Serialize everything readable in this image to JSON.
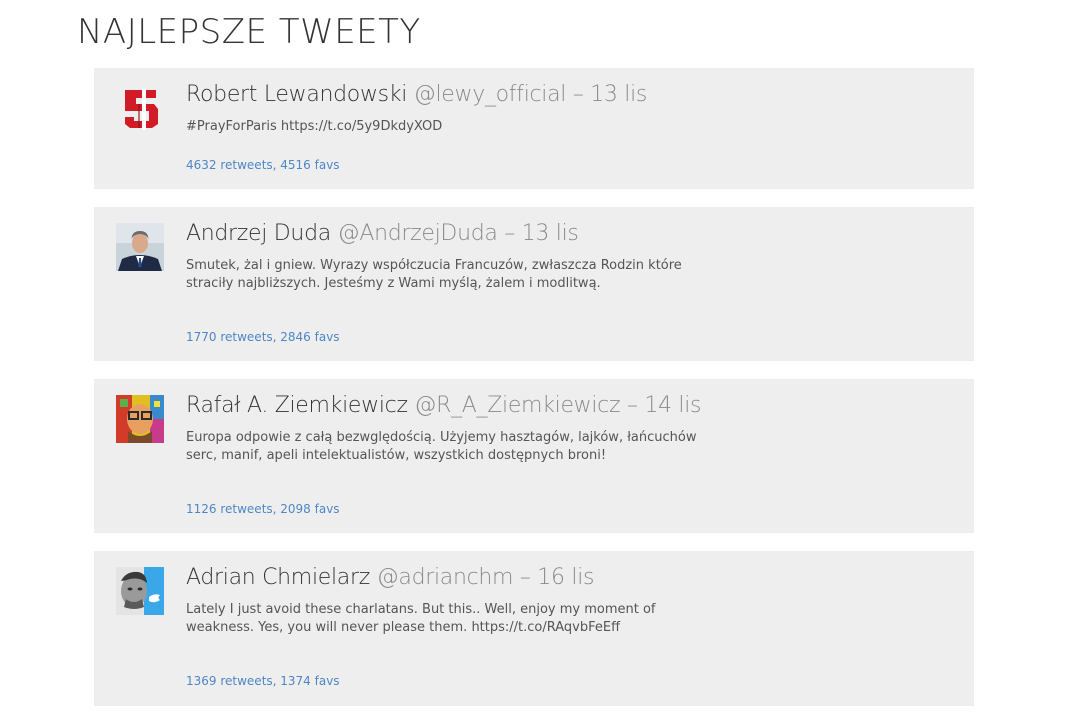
{
  "page": {
    "title": "NAJLEPSZE TWEETY"
  },
  "colors": {
    "card_bg": "#eeeeee",
    "link": "#4f86c6",
    "muted": "#8a8a8a"
  },
  "tweets": [
    {
      "name": "Robert Lewandowski",
      "handle": "@lewy_official",
      "separator": "–",
      "date": "13 lis",
      "text": "#PrayForParis https://t.co/5y9DkdyXOD",
      "stats": "4632 retweets, 4516 favs",
      "avatar_icon": "number-9-logo-avatar"
    },
    {
      "name": "Andrzej Duda",
      "handle": "@AndrzejDuda",
      "separator": "–",
      "date": "13 lis",
      "text": "Smutek, żal i gniew. Wyrazy współczucia Francuzów, zwłaszcza Rodzin które straciły najbliższych. Jesteśmy z Wami myślą, żalem i modlitwą.",
      "stats": "1770 retweets, 2846 favs",
      "avatar_icon": "portrait-avatar"
    },
    {
      "name": "Rafał A. Ziemkiewicz",
      "handle": "@R_A_Ziemkiewicz",
      "separator": "–",
      "date": "14 lis",
      "text": "Europa odpowie z całą bezwględością. Użyjemy hasztagów, lajków, łańcuchów serc, manif, apeli intelektualistów, wszystkich dostępnych broni!",
      "stats": "1126 retweets, 2098 favs",
      "avatar_icon": "colorful-portrait-avatar"
    },
    {
      "name": "Adrian Chmielarz",
      "handle": "@adrianchm",
      "separator": "–",
      "date": "16 lis",
      "text": "Lately I just avoid these charlatans. But this.. Well, enjoy my moment of weakness. Yes, you will never please them. https://t.co/RAqvbFeEff",
      "stats": "1369 retweets, 1374 favs",
      "avatar_icon": "bw-portrait-twitter-avatar"
    }
  ]
}
